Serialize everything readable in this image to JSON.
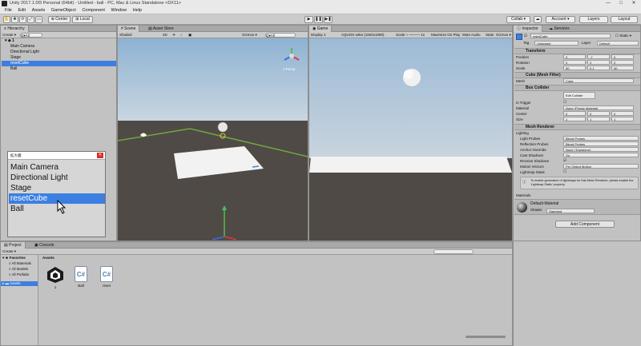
{
  "window": {
    "title": "Unity 2017.1.0f3 Personal (64bit) - Untitled - ball - PC, Mac & Linux Standalone <DX11>",
    "minimize": "—",
    "maximize": "□",
    "close": "✕"
  },
  "menu": [
    "File",
    "Edit",
    "Assets",
    "GameObject",
    "Component",
    "Window",
    "Help"
  ],
  "toolbar": {
    "center": "Center",
    "local": "Local",
    "play": "▶",
    "pause": "❚❚",
    "step": "▶❚",
    "collab": "Collab ▾",
    "account": "Account ▾",
    "layers": "Layers",
    "layout": "Layout"
  },
  "hierarchy": {
    "tab": "Hierarchy",
    "create": "Create ▾",
    "search_placeholder": "Q▾All",
    "scene_name": "1",
    "items": [
      "Main Camera",
      "Directional Light",
      "Stage",
      "resetCube",
      "Ball"
    ]
  },
  "zoom_window": {
    "title": "拡大鏡",
    "items": [
      "Main Camera",
      "Directional Light",
      "Stage",
      "resetCube",
      "Ball"
    ]
  },
  "scene": {
    "tabs": [
      "Scene",
      "Asset Store"
    ],
    "shading": "Shaded",
    "mode2d": "2D",
    "gizmos": "Gizmos ▾",
    "search_placeholder": "Q▾All",
    "persp": "≡ Persp"
  },
  "game": {
    "tab": "Game",
    "display": "Display 1",
    "aspect": "AQUOS seke (1920x1080)",
    "scale": "Scale ○ ——— 1x",
    "maximize": "Maximize On Play",
    "mute": "Mute Audio",
    "stats": "Stats",
    "gizmos": "Gizmos ▾"
  },
  "inspector": {
    "tabs": [
      "Inspector",
      "Services"
    ],
    "object_name": "resetCube",
    "static": "Static ▾",
    "tag_label": "Tag",
    "tag": "Untagged",
    "layer_label": "Layer",
    "layer": "Default",
    "transform": {
      "title": "Transform",
      "position_label": "Position",
      "position": [
        "0",
        "-7",
        "0"
      ],
      "rotation_label": "Rotation",
      "rotation": [
        "0",
        "0",
        "0"
      ],
      "scale_label": "Scale",
      "scale": [
        "50",
        "0.1",
        "50"
      ]
    },
    "mesh_filter": {
      "title": "Cube (Mesh Filter)",
      "mesh_label": "Mesh",
      "mesh": "Cube"
    },
    "box_collider": {
      "title": "Box Collider",
      "edit": "Edit Collider",
      "is_trigger_label": "Is Trigger",
      "material_label": "Material",
      "material": "None (Physic Material)",
      "center_label": "Center",
      "center": [
        "0",
        "0",
        "0"
      ],
      "size_label": "Size",
      "size": [
        "1",
        "1",
        "1"
      ]
    },
    "mesh_renderer": {
      "title": "Mesh Renderer",
      "lighting": "Lighting",
      "light_probes_label": "Light Probes",
      "light_probes": "Blend Probes",
      "reflection_probes_label": "Reflection Probes",
      "reflection_probes": "Blend Probes",
      "anchor_label": "Anchor Override",
      "anchor": "None (Transform)",
      "cast_shadows_label": "Cast Shadows",
      "cast_shadows": "On",
      "receive_shadows_label": "Receive Shadows",
      "motion_vectors_label": "Motion Vectors",
      "motion_vectors": "Per Object Motion",
      "lightmap_static_label": "Lightmap Static",
      "info": "To enable generation of lightmaps for this Mesh Renderer, please enable the 'Lightmap Static' property."
    },
    "materials_label": "Materials",
    "material_name": "Default-Material",
    "shader_label": "Shader",
    "shader": "Standard",
    "add_component": "Add Component"
  },
  "project": {
    "tabs": [
      "Project",
      "Console"
    ],
    "create": "Create ▾",
    "favorites": "Favorites",
    "fav_items": [
      "All Materials",
      "All Models",
      "All Prefabs"
    ],
    "assets_root": "Assets",
    "breadcrumb": "Assets",
    "assets": [
      "1",
      "Ball",
      "reset"
    ]
  },
  "colors": {
    "selection": "#3d7fe0",
    "arrow": "#e0207a",
    "sky": "#a9c4dc",
    "ground": "#4f4a45"
  }
}
